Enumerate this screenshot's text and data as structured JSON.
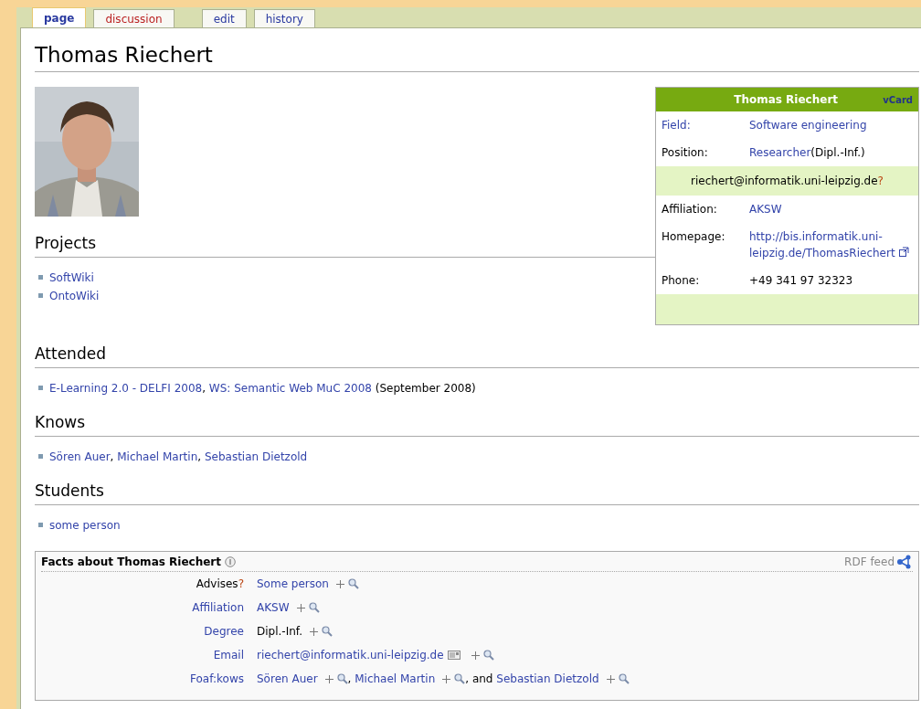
{
  "tabs": [
    {
      "label": "page",
      "selected": true,
      "kind": "normal"
    },
    {
      "label": "discussion",
      "selected": false,
      "kind": "new"
    },
    {
      "label": "edit",
      "selected": false,
      "kind": "normal"
    },
    {
      "label": "history",
      "selected": false,
      "kind": "normal"
    }
  ],
  "title": "Thomas Riechert",
  "infobox": {
    "title": "Thomas Riechert",
    "vcard": "vCard",
    "rows": [
      {
        "kind": "pair",
        "label": "Field:",
        "label_link": true,
        "value": [
          {
            "text": "Software engineering",
            "link": true
          }
        ]
      },
      {
        "kind": "pair",
        "label": "Position:",
        "label_link": false,
        "value": [
          {
            "text": "Researcher",
            "link": true
          },
          {
            "text": "(Dipl.-Inf.)",
            "link": false
          }
        ]
      },
      {
        "kind": "wide",
        "value": [
          {
            "text": "riechert@informatik.uni-leipzig.de",
            "link": false
          },
          {
            "text": "?",
            "missing": true
          }
        ]
      },
      {
        "kind": "pair",
        "label": "Affiliation:",
        "label_link": false,
        "value": [
          {
            "text": "AKSW",
            "link": true
          }
        ]
      },
      {
        "kind": "pair",
        "label": "Homepage:",
        "label_link": false,
        "value": [
          {
            "text": "http://bis.informatik.uni-leipzig.de/ThomasRiechert",
            "link": true,
            "external": true
          }
        ]
      },
      {
        "kind": "pair",
        "label": "Phone:",
        "label_link": false,
        "value": [
          {
            "text": "+49 341 97 32323",
            "link": false
          }
        ]
      },
      {
        "kind": "footer"
      }
    ]
  },
  "sections": [
    {
      "heading": "Projects",
      "items": [
        [
          {
            "text": "SoftWiki",
            "link": true
          }
        ],
        [
          {
            "text": "OntoWiki",
            "link": true
          }
        ]
      ]
    },
    {
      "heading": "Attended",
      "items": [
        [
          {
            "text": "E-Learning 2.0 - DELFI 2008",
            "link": true
          },
          {
            "text": ", ",
            "link": false
          },
          {
            "text": "WS: Semantic Web MuC 2008",
            "link": true
          },
          {
            "text": " (September 2008)",
            "link": false
          }
        ]
      ]
    },
    {
      "heading": "Knows",
      "items": [
        [
          {
            "text": "Sören Auer",
            "link": true
          },
          {
            "text": ", ",
            "link": false
          },
          {
            "text": "Michael Martin",
            "link": true
          },
          {
            "text": ", ",
            "link": false
          },
          {
            "text": "Sebastian Dietzold",
            "link": true
          }
        ]
      ]
    },
    {
      "heading": "Students",
      "items": [
        [
          {
            "text": "some person",
            "link": true
          }
        ]
      ]
    }
  ],
  "facts": {
    "title": "Facts about Thomas Riechert",
    "rdf": "RDF feed",
    "rows": [
      {
        "property": "Advises",
        "property_link": false,
        "missing": "?",
        "values": [
          {
            "kind": "value",
            "text": "Some person",
            "link": true
          }
        ]
      },
      {
        "property": "Affiliation",
        "property_link": true,
        "values": [
          {
            "kind": "value",
            "text": "AKSW",
            "link": true
          }
        ]
      },
      {
        "property": "Degree",
        "property_link": true,
        "values": [
          {
            "kind": "value",
            "text": "Dipl.-Inf.",
            "link": false
          }
        ]
      },
      {
        "property": "Email",
        "property_link": true,
        "values": [
          {
            "kind": "value",
            "text": "riechert@informatik.uni-leipzig.de",
            "link": true,
            "email": true
          }
        ]
      },
      {
        "property": "Foaf:kows",
        "property_link": true,
        "values": [
          {
            "kind": "value",
            "text": "Sören Auer",
            "link": true
          },
          {
            "kind": "separator",
            "text": ", "
          },
          {
            "kind": "value",
            "text": "Michael Martin",
            "link": true
          },
          {
            "kind": "separator",
            "text": ", and "
          },
          {
            "kind": "value",
            "text": "Sebastian Dietzold",
            "link": true
          }
        ]
      }
    ]
  }
}
